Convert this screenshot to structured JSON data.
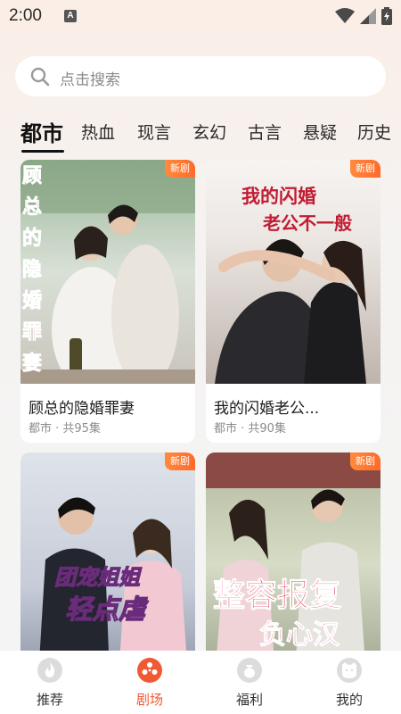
{
  "status_bar": {
    "time": "2:00",
    "notification_letter": "A"
  },
  "search": {
    "placeholder": "点击搜索"
  },
  "tabs": [
    {
      "label": "都市",
      "active": true
    },
    {
      "label": "热血",
      "active": false
    },
    {
      "label": "现言",
      "active": false
    },
    {
      "label": "玄幻",
      "active": false
    },
    {
      "label": "古言",
      "active": false
    },
    {
      "label": "悬疑",
      "active": false
    },
    {
      "label": "历史",
      "active": false
    }
  ],
  "cards": [
    {
      "title": "顾总的隐婚罪妻",
      "meta": "都市 · 共95集",
      "badge": "新剧",
      "poster_text": "顾总的隐婚罪妻"
    },
    {
      "title": "我的闪婚老公...",
      "meta": "都市 · 共90集",
      "badge": "新剧",
      "poster_text": "我的闪婚老公不一般"
    },
    {
      "title": "",
      "meta": "",
      "badge": "新剧",
      "poster_text": "团宠姐姐轻点虐"
    },
    {
      "title": "",
      "meta": "",
      "badge": "新剧",
      "poster_text": "整容报复负心汉"
    }
  ],
  "bottom_nav": [
    {
      "label": "推荐",
      "icon": "flame-icon",
      "active": false
    },
    {
      "label": "剧场",
      "icon": "film-reel-icon",
      "active": true
    },
    {
      "label": "福利",
      "icon": "gift-bag-icon",
      "active": false
    },
    {
      "label": "我的",
      "icon": "profile-icon",
      "active": false
    }
  ],
  "colors": {
    "accent": "#ef5a35",
    "badge": "#ff7a33"
  }
}
